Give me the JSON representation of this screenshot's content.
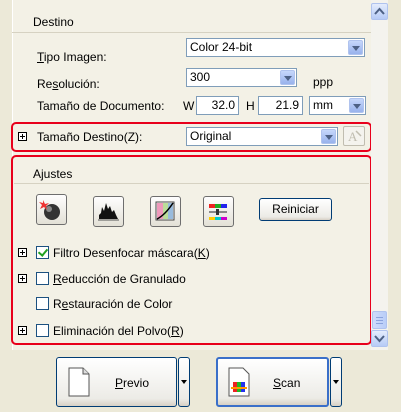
{
  "destino": {
    "header": "Destino",
    "tipo_imagen": {
      "label": "Tipo Imagen:",
      "value": "Color 24-bit"
    },
    "resolucion": {
      "label": "Resolución:",
      "value": "300",
      "unit": "ppp"
    },
    "tamano_documento": {
      "label": "Tamaño de Documento:",
      "w_label": "W",
      "w_value": "32.0",
      "h_label": "H",
      "h_value": "21.9",
      "unit": "mm"
    },
    "tamano_destino": {
      "label": "Tamaño Destino(Z):",
      "value": "Original"
    }
  },
  "ajustes": {
    "header": "Ajustes",
    "tool_icons": [
      "auto-exposure-icon",
      "histogram-icon",
      "tone-curve-icon",
      "color-palette-icon"
    ],
    "reset_label": "Reiniciar",
    "options": [
      {
        "label": "Filtro Desenfocar máscara(K)",
        "checked": true,
        "expandable": true
      },
      {
        "label": "Reducción de Granulado",
        "checked": false,
        "expandable": true
      },
      {
        "label": "Restauración de Color",
        "checked": false,
        "expandable": false
      },
      {
        "label": "Eliminación del Polvo(R)",
        "checked": false,
        "expandable": true
      }
    ]
  },
  "footer": {
    "preview_label": "Previo",
    "scan_label": "Scan"
  },
  "colors": {
    "highlight": "#e8001c",
    "panel": "#f3f1e6",
    "window": "#ece9d8"
  }
}
